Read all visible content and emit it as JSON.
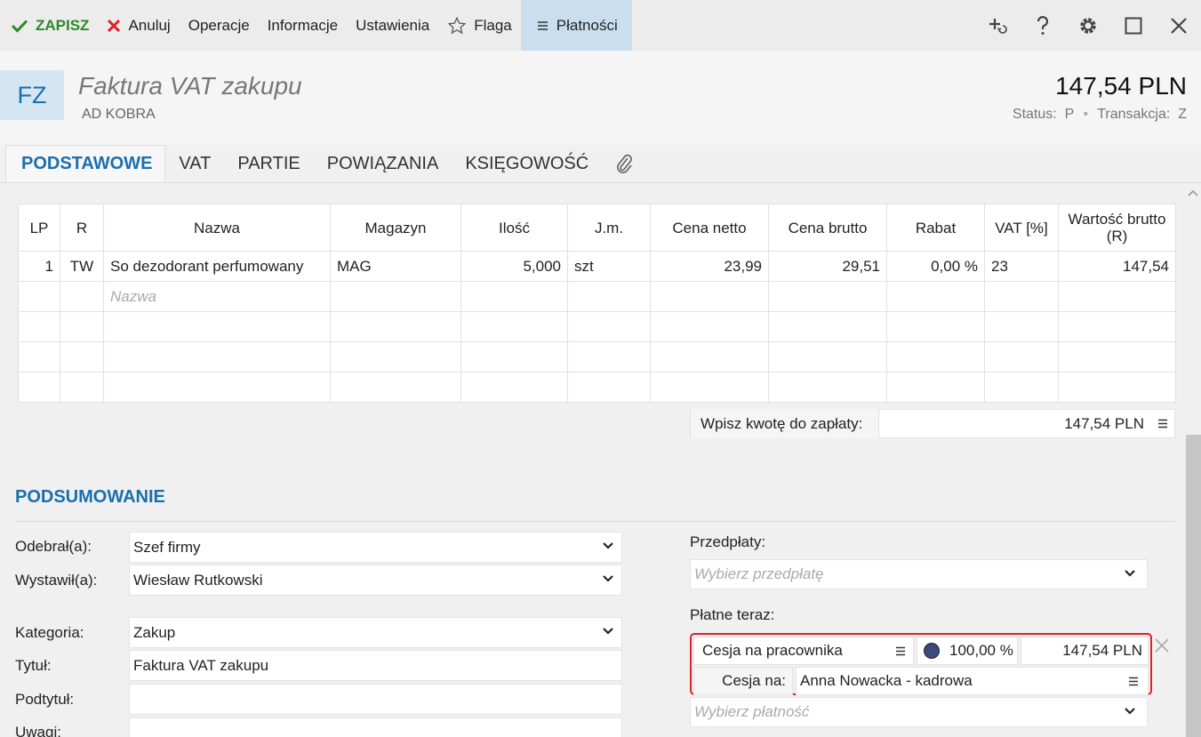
{
  "toolbar": {
    "save": "ZAPISZ",
    "cancel": "Anuluj",
    "operations": "Operacje",
    "information": "Informacje",
    "settings": "Ustawienia",
    "flag": "Flaga",
    "payments": "Płatności"
  },
  "header": {
    "badge": "FZ",
    "title": "Faktura VAT zakupu",
    "contractor": "AD KOBRA",
    "amount": "147,54 PLN",
    "status_label": "Status:",
    "status_value": "P",
    "transaction_label": "Transakcja:",
    "transaction_value": "Z"
  },
  "tabs": [
    "PODSTAWOWE",
    "VAT",
    "PARTIE",
    "POWIĄZANIA",
    "KSIĘGOWOŚĆ"
  ],
  "grid": {
    "columns": [
      "LP",
      "R",
      "Nazwa",
      "Magazyn",
      "Ilość",
      "J.m.",
      "Cena netto",
      "Cena brutto",
      "Rabat",
      "VAT [%]",
      "Wartość brutto (R)"
    ],
    "row": {
      "lp": "1",
      "r": "TW",
      "name": "So dezodorant perfumowany",
      "warehouse": "MAG",
      "qty": "5,000",
      "unit": "szt",
      "net": "23,99",
      "gross": "29,51",
      "discount": "0,00 %",
      "vat": "23",
      "total": "147,54"
    },
    "name_placeholder": "Nazwa"
  },
  "to_pay": {
    "label": "Wpisz kwotę do zapłaty:",
    "value": "147,54 PLN"
  },
  "summary": {
    "title": "PODSUMOWANIE",
    "received_label": "Odebrał(a):",
    "received_value": "Szef firmy",
    "issued_label": "Wystawił(a):",
    "issued_value": "Wiesław Rutkowski",
    "category_label": "Kategoria:",
    "category_value": "Zakup",
    "title_label": "Tytuł:",
    "title_value": "Faktura VAT zakupu",
    "subtitle_label": "Podtytuł:",
    "notes_label": "Uwagi:"
  },
  "payments": {
    "prepayments_label": "Przedpłaty:",
    "prepayments_placeholder": "Wybierz przedpłatę",
    "paid_now_label": "Płatne teraz:",
    "method": "Cesja na pracownika",
    "percent": "100,00 %",
    "amount": "147,54 PLN",
    "cession_label": "Cesja na:",
    "cession_value": "Anna Nowacka - kadrowa",
    "choose_payment_placeholder": "Wybierz płatność",
    "dot_color": "#3b4a7a"
  }
}
